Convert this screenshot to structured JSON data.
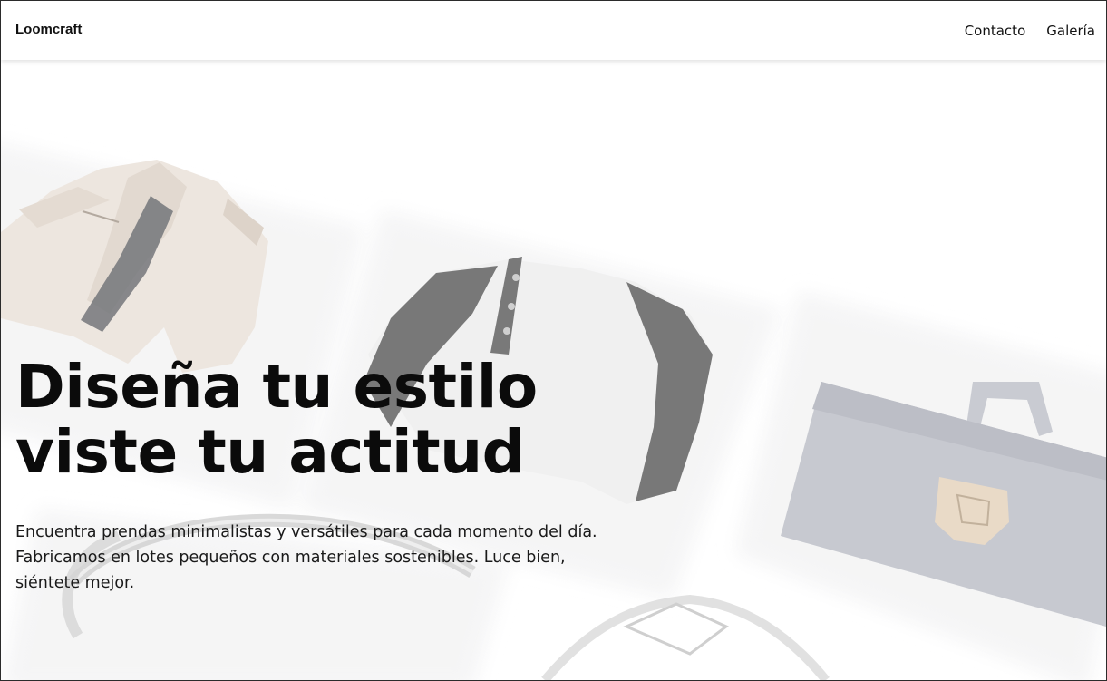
{
  "brand": {
    "name": "Loomcraft"
  },
  "nav": {
    "items": [
      {
        "label": "Contacto"
      },
      {
        "label": "Galería"
      }
    ]
  },
  "hero": {
    "title_line1": "Diseña tu estilo",
    "title_line2": "viste tu actitud",
    "description": "Encuentra prendas minimalistas y versátiles para cada momento del día. Fabricamos en lotes pequeños con materiales sostenibles. Luce bien, siéntete mejor."
  },
  "background_images": [
    {
      "name": "jacket-image",
      "subject": "beige jacket"
    },
    {
      "name": "raglan-shirt-image",
      "subject": "raglan henley shirt"
    },
    {
      "name": "backpack-image",
      "subject": "grey backpack"
    },
    {
      "name": "ring-image",
      "subject": "diamond ring"
    }
  ],
  "colors": {
    "text": "#111111",
    "header_bg": "#ffffff",
    "page_bg": "#ffffff"
  }
}
